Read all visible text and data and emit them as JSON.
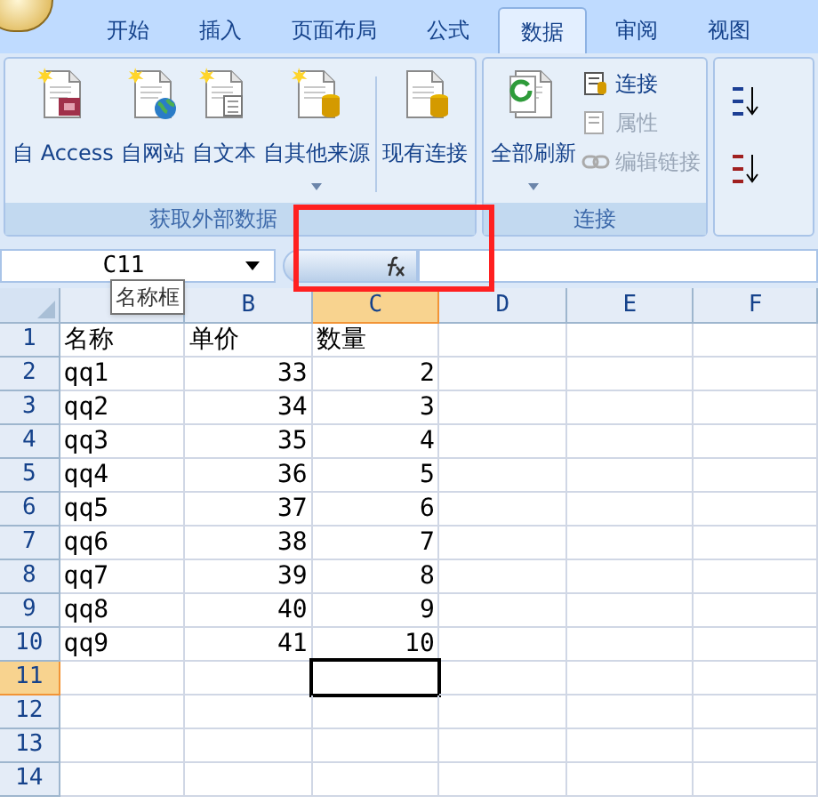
{
  "tabs": [
    {
      "label": "开始",
      "selected": false
    },
    {
      "label": "插入",
      "selected": false
    },
    {
      "label": "页面布局",
      "selected": false
    },
    {
      "label": "公式",
      "selected": false
    },
    {
      "label": "数据",
      "selected": true
    },
    {
      "label": "审阅",
      "selected": false
    },
    {
      "label": "视图",
      "selected": false
    }
  ],
  "ribbon": {
    "groups": [
      {
        "label": "获取外部数据",
        "buttons": [
          {
            "kind": "big",
            "label": "自 Access",
            "dropdown": false
          },
          {
            "kind": "big",
            "label": "自网站",
            "dropdown": false
          },
          {
            "kind": "big",
            "label": "自文本",
            "dropdown": false
          },
          {
            "kind": "big",
            "label": "自其他来源",
            "dropdown": true
          },
          {
            "kind": "separator"
          },
          {
            "kind": "big",
            "label": "现有连接",
            "dropdown": false
          }
        ]
      },
      {
        "label": "连接",
        "buttons": [
          {
            "kind": "big",
            "label": "全部刷新",
            "dropdown": true
          },
          {
            "kind": "small",
            "label": "连接",
            "disabled": false
          },
          {
            "kind": "small",
            "label": "属性",
            "disabled": true
          },
          {
            "kind": "small",
            "label": "编辑链接",
            "disabled": true
          }
        ]
      }
    ]
  },
  "formula_bar": {
    "name_box": "C11",
    "tooltip": "名称框"
  },
  "sheet": {
    "columns": [
      {
        "selected": false
      },
      {
        "label": "B",
        "selected": false
      },
      {
        "label": "C",
        "selected": true
      },
      {
        "label": "D",
        "selected": false
      },
      {
        "label": "E",
        "selected": false
      },
      {
        "label": "F",
        "selected": false
      }
    ],
    "rows": [
      {
        "number": "1",
        "selected": false,
        "cells": [
          {
            "text": "名称",
            "kind": "text"
          },
          {
            "text": "单价",
            "kind": "text"
          },
          {
            "text": "数量",
            "kind": "text"
          }
        ]
      },
      {
        "number": "2",
        "selected": false,
        "cells": [
          {
            "text": "qq1",
            "kind": "text"
          },
          {
            "text": "33",
            "kind": "number"
          },
          {
            "text": "2",
            "kind": "number"
          }
        ]
      },
      {
        "number": "3",
        "selected": false,
        "cells": [
          {
            "text": "qq2",
            "kind": "text"
          },
          {
            "text": "34",
            "kind": "number"
          },
          {
            "text": "3",
            "kind": "number"
          }
        ]
      },
      {
        "number": "4",
        "selected": false,
        "cells": [
          {
            "text": "qq3",
            "kind": "text"
          },
          {
            "text": "35",
            "kind": "number"
          },
          {
            "text": "4",
            "kind": "number"
          }
        ]
      },
      {
        "number": "5",
        "selected": false,
        "cells": [
          {
            "text": "qq4",
            "kind": "text"
          },
          {
            "text": "36",
            "kind": "number"
          },
          {
            "text": "5",
            "kind": "number"
          }
        ]
      },
      {
        "number": "6",
        "selected": false,
        "cells": [
          {
            "text": "qq5",
            "kind": "text"
          },
          {
            "text": "37",
            "kind": "number"
          },
          {
            "text": "6",
            "kind": "number"
          }
        ]
      },
      {
        "number": "7",
        "selected": false,
        "cells": [
          {
            "text": "qq6",
            "kind": "text"
          },
          {
            "text": "38",
            "kind": "number"
          },
          {
            "text": "7",
            "kind": "number"
          }
        ]
      },
      {
        "number": "8",
        "selected": false,
        "cells": [
          {
            "text": "qq7",
            "kind": "text"
          },
          {
            "text": "39",
            "kind": "number"
          },
          {
            "text": "8",
            "kind": "number"
          }
        ]
      },
      {
        "number": "9",
        "selected": false,
        "cells": [
          {
            "text": "qq8",
            "kind": "text"
          },
          {
            "text": "40",
            "kind": "number"
          },
          {
            "text": "9",
            "kind": "number"
          }
        ]
      },
      {
        "number": "10",
        "selected": false,
        "cells": [
          {
            "text": "qq9",
            "kind": "text"
          },
          {
            "text": "41",
            "kind": "number"
          },
          {
            "text": "10",
            "kind": "number"
          }
        ]
      },
      {
        "number": "11",
        "selected": true,
        "cells": []
      },
      {
        "number": "12",
        "selected": false,
        "cells": []
      },
      {
        "number": "13",
        "selected": false,
        "cells": []
      },
      {
        "number": "14",
        "selected": false,
        "cells": []
      }
    ]
  }
}
